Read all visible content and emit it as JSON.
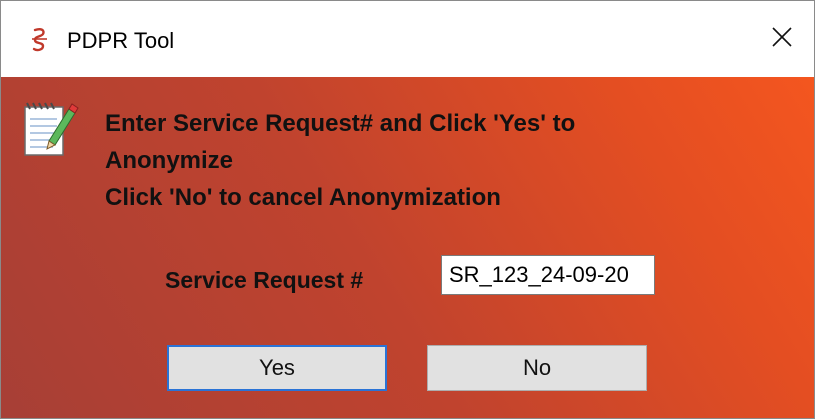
{
  "window": {
    "title": "PDPR Tool",
    "app_icon": "pdpr-app-icon",
    "close_icon": "close-icon"
  },
  "dialog": {
    "icon": "notepad-pencil-icon",
    "message_lines": [
      "Enter Service Request# and Click 'Yes' to",
      "Anonymize",
      "Click 'No' to cancel Anonymization"
    ],
    "field_label": "Service Request #",
    "field_value": "SR_123_24-09-20",
    "yes_label": "Yes",
    "no_label": "No"
  },
  "colors": {
    "gradient_start": "#a73f36",
    "gradient_end": "#f4561f",
    "focus_border": "#2a73d6",
    "button_face": "#e1e1e1"
  }
}
